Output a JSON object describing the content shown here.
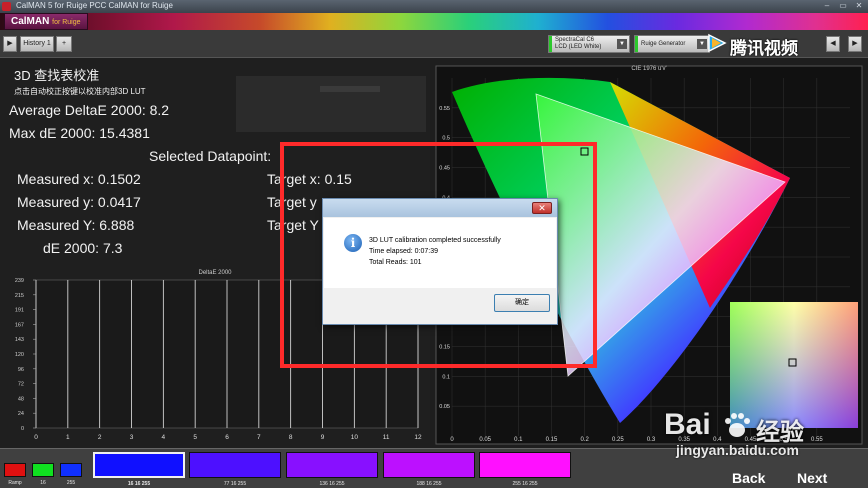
{
  "window": {
    "title": "CalMAN 5 for Ruige PCC CalMAN for Ruige",
    "brand_main": "CalMAN",
    "brand_sub": "for Ruige"
  },
  "toolbar": {
    "history_tab": "History 1",
    "add_label": "+",
    "source_dropdown_line1": "SpectraCal C6",
    "source_dropdown_line2": "LCD (LED White)",
    "generator_dropdown": "Ruige Generator"
  },
  "panel": {
    "heading": "3D 查找表校准",
    "instruction": "点击自动校正按键以校准内部3D LUT",
    "avg_de": "Average DeltaE 2000: 8.2",
    "max_de": "Max dE 2000: 15.4381",
    "selected_title": "Selected Datapoint:",
    "measured_x": "Measured x: 0.1502",
    "measured_y": "Measured y: 0.0417",
    "measured_Y": "Measured Y: 6.888",
    "de": "dE 2000: 7.3",
    "target_x": "Target x: 0.15",
    "target_y": "Target y",
    "target_Y": "Target Y"
  },
  "chart_data": [
    {
      "type": "bar",
      "title": "DeltaE 2000",
      "xlabel": "",
      "ylabel": "",
      "x_ticks": [
        "0",
        "1",
        "2",
        "3",
        "4",
        "5",
        "6",
        "7",
        "8",
        "9",
        "10",
        "11",
        "12"
      ],
      "y_ticks": [
        "0",
        "24",
        "48",
        "72",
        "96",
        "120",
        "143",
        "167",
        "191",
        "215",
        "239"
      ],
      "xlim": [
        0,
        12
      ],
      "ylim": [
        0,
        239
      ],
      "grid": true
    },
    {
      "type": "scatter",
      "title": "CIE 1976 u'v'",
      "x_ticks": [
        "0",
        "0.05",
        "0.1",
        "0.15",
        "0.2",
        "0.25",
        "0.3",
        "0.35",
        "0.4",
        "0.45",
        "0.5",
        "0.55"
      ],
      "y_ticks": [
        "0.05",
        "0.1",
        "0.15",
        "0.2",
        "0.25",
        "0.3",
        "0.35",
        "0.4",
        "0.45",
        "0.5",
        "0.55"
      ],
      "xlim": [
        0,
        0.6
      ],
      "ylim": [
        0,
        0.6
      ],
      "grid": true
    }
  ],
  "dialog": {
    "line1": "3D LUT calibration completed successfully",
    "line2": "Time elapsed: 0:07:39",
    "line3": "Total Reads: 101",
    "ok_label": "确定",
    "close_label": "✕"
  },
  "swatches": {
    "rgb_labels": [
      "Ramp",
      "16",
      "255"
    ],
    "patches": [
      {
        "label": "16 16 255",
        "color": "#1010ff"
      },
      {
        "label": "77 16 255",
        "color": "#4d10ff"
      },
      {
        "label": "136 16 255",
        "color": "#8810ff"
      },
      {
        "label": "188 16 255",
        "color": "#bc10ff"
      },
      {
        "label": "255 16 255",
        "color": "#ff10ff"
      }
    ]
  },
  "nav": {
    "back": "Back",
    "next": "Next"
  },
  "watermark": {
    "video_text": "腾讯视频",
    "site_text": "jingyan.baidu.com",
    "baidu_text": "Bai",
    "jingyan_text": "经验"
  }
}
